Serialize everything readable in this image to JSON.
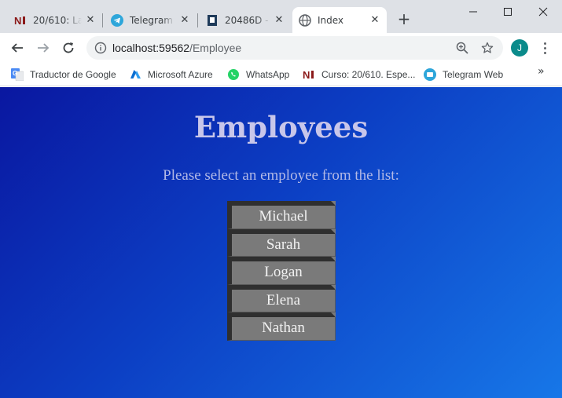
{
  "browser": {
    "tabs": [
      {
        "title": "20/610: La",
        "icon": "netex-icon"
      },
      {
        "title": "Telegram W",
        "icon": "telegram-icon"
      },
      {
        "title": "20486D - D",
        "icon": "document-icon"
      },
      {
        "title": "Index",
        "icon": "globe-icon",
        "active": true
      }
    ],
    "new_tab_label": "+",
    "address": {
      "host": "localhost:59562",
      "path": "/Employee"
    },
    "profile_initial": "J",
    "bookmarks": [
      {
        "label": "Traductor de Google",
        "icon": "google-translate-icon"
      },
      {
        "label": "Microsoft Azure",
        "icon": "azure-icon"
      },
      {
        "label": "WhatsApp",
        "icon": "whatsapp-icon"
      },
      {
        "label": "Curso: 20/610. Espe...",
        "icon": "netex-icon"
      },
      {
        "label": "Telegram Web",
        "icon": "telegram-icon"
      }
    ],
    "bookmarks_overflow": "»",
    "colors": {
      "page_gradient_start": "#0a17a0",
      "page_gradient_end": "#1777e8",
      "button_face": "#7a7a7a",
      "button_shadow": "#2f2f2f",
      "profile": "#0b8b8b"
    }
  },
  "page": {
    "heading": "Employees",
    "subtitle": "Please select an employee from the list:",
    "employees": [
      "Michael",
      "Sarah",
      "Logan",
      "Elena",
      "Nathan"
    ]
  }
}
